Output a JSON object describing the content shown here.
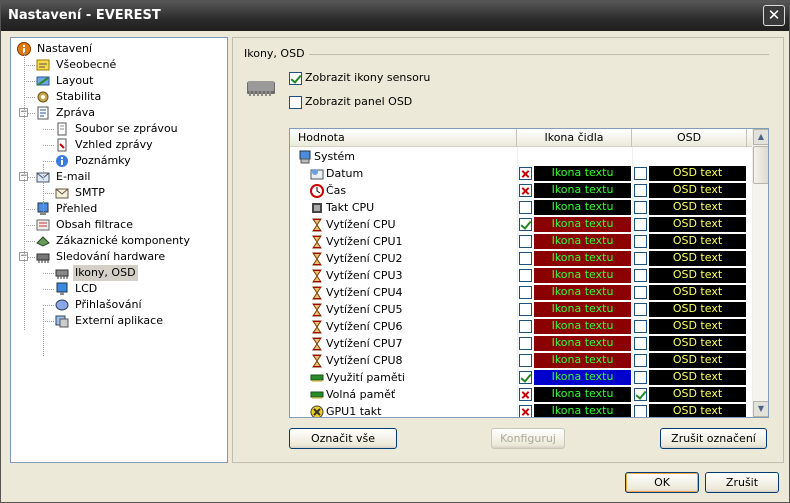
{
  "window": {
    "title": "Nastavení - EVEREST",
    "close_glyph": "✕"
  },
  "tree": [
    {
      "label": "Nastavení",
      "icon": "info-icon",
      "level": 0,
      "expander": ""
    },
    {
      "label": "Všeobecné",
      "icon": "general-settings-icon",
      "level": 1,
      "expander": ""
    },
    {
      "label": "Layout",
      "icon": "layout-icon",
      "level": 1,
      "expander": ""
    },
    {
      "label": "Stabilita",
      "icon": "stability-icon",
      "level": 1,
      "expander": ""
    },
    {
      "label": "Zpráva",
      "icon": "report-icon",
      "level": 1,
      "expander": "−"
    },
    {
      "label": "Soubor se zprávou",
      "icon": "report-file-icon",
      "level": 2,
      "expander": ""
    },
    {
      "label": "Vzhled zprávy",
      "icon": "report-look-icon",
      "level": 2,
      "expander": ""
    },
    {
      "label": "Poznámky",
      "icon": "notes-icon",
      "level": 2,
      "expander": ""
    },
    {
      "label": "E-mail",
      "icon": "email-icon",
      "level": 1,
      "expander": "−"
    },
    {
      "label": "SMTP",
      "icon": "smtp-icon",
      "level": 2,
      "expander": ""
    },
    {
      "label": "Přehled",
      "icon": "overview-icon",
      "level": 1,
      "expander": ""
    },
    {
      "label": "Obsah filtrace",
      "icon": "filter-icon",
      "level": 1,
      "expander": ""
    },
    {
      "label": "Zákaznické komponenty",
      "icon": "custom-components-icon",
      "level": 1,
      "expander": ""
    },
    {
      "label": "Sledování hardware",
      "icon": "hardware-monitor-icon",
      "level": 1,
      "expander": "−"
    },
    {
      "label": "Ikony, OSD",
      "icon": "chip-icon",
      "level": 2,
      "expander": "",
      "selected": true
    },
    {
      "label": "LCD",
      "icon": "lcd-icon",
      "level": 2,
      "expander": ""
    },
    {
      "label": "Přihlašování",
      "icon": "logging-icon",
      "level": 2,
      "expander": ""
    },
    {
      "label": "Externí aplikace",
      "icon": "external-app-icon",
      "level": 2,
      "expander": ""
    }
  ],
  "panel": {
    "section_title": "Ikony, OSD",
    "show_sensor_icons": {
      "label": "Zobrazit ikony sensoru",
      "checked": true
    },
    "show_osd_panel": {
      "label": "Zobrazit panel OSD",
      "checked": false
    },
    "columns": {
      "name": "Hodnota",
      "icon": "Ikona čidla",
      "osd": "OSD"
    },
    "rows": [
      {
        "name": "Systém",
        "icon": "computer-icon",
        "group": true
      },
      {
        "name": "Datum",
        "icon": "date-icon",
        "icon_state": "crossed",
        "icon_text": "Ikona textu",
        "icon_bg": "#000000",
        "osd_state": "empty",
        "osd_text": "OSD text"
      },
      {
        "name": "Čas",
        "icon": "clock-icon",
        "icon_state": "crossed",
        "icon_text": "Ikona textu",
        "icon_bg": "#000000",
        "osd_state": "empty",
        "osd_text": "OSD text"
      },
      {
        "name": "Takt CPU",
        "icon": "cpu-icon",
        "icon_state": "empty",
        "icon_text": "Ikona textu",
        "icon_bg": "#000000",
        "osd_state": "empty",
        "osd_text": "OSD text"
      },
      {
        "name": "Vytížení CPU",
        "icon": "hourglass-icon",
        "icon_state": "checked",
        "icon_text": "Ikona textu",
        "icon_bg": "#8b0000",
        "osd_state": "empty",
        "osd_text": "OSD text"
      },
      {
        "name": "Vytížení CPU1",
        "icon": "hourglass-icon",
        "icon_state": "empty",
        "icon_text": "Ikona textu",
        "icon_bg": "#8b0000",
        "osd_state": "empty",
        "osd_text": "OSD text"
      },
      {
        "name": "Vytížení CPU2",
        "icon": "hourglass-icon",
        "icon_state": "empty",
        "icon_text": "Ikona textu",
        "icon_bg": "#8b0000",
        "osd_state": "empty",
        "osd_text": "OSD text"
      },
      {
        "name": "Vytížení CPU3",
        "icon": "hourglass-icon",
        "icon_state": "empty",
        "icon_text": "Ikona textu",
        "icon_bg": "#8b0000",
        "osd_state": "empty",
        "osd_text": "OSD text"
      },
      {
        "name": "Vytížení CPU4",
        "icon": "hourglass-icon",
        "icon_state": "empty",
        "icon_text": "Ikona textu",
        "icon_bg": "#8b0000",
        "osd_state": "empty",
        "osd_text": "OSD text"
      },
      {
        "name": "Vytížení CPU5",
        "icon": "hourglass-icon",
        "icon_state": "empty",
        "icon_text": "Ikona textu",
        "icon_bg": "#8b0000",
        "osd_state": "empty",
        "osd_text": "OSD text"
      },
      {
        "name": "Vytížení CPU6",
        "icon": "hourglass-icon",
        "icon_state": "empty",
        "icon_text": "Ikona textu",
        "icon_bg": "#8b0000",
        "osd_state": "empty",
        "osd_text": "OSD text"
      },
      {
        "name": "Vytížení CPU7",
        "icon": "hourglass-icon",
        "icon_state": "empty",
        "icon_text": "Ikona textu",
        "icon_bg": "#8b0000",
        "osd_state": "empty",
        "osd_text": "OSD text"
      },
      {
        "name": "Vytížení CPU8",
        "icon": "hourglass-icon",
        "icon_state": "empty",
        "icon_text": "Ikona textu",
        "icon_bg": "#8b0000",
        "osd_state": "empty",
        "osd_text": "OSD text"
      },
      {
        "name": "Využití paměti",
        "icon": "memory-icon",
        "icon_state": "checked",
        "icon_text": "Ikona textu",
        "icon_bg": "#0000cc",
        "osd_state": "empty",
        "osd_text": "OSD text"
      },
      {
        "name": "Volná paměť",
        "icon": "memory-icon",
        "icon_state": "crossed",
        "icon_text": "Ikona textu",
        "icon_bg": "#000000",
        "osd_state": "checked",
        "osd_text": "OSD text"
      },
      {
        "name": "GPU1 takt",
        "icon": "gpu-icon",
        "icon_state": "crossed",
        "icon_text": "Ikona textu",
        "icon_bg": "#000000",
        "osd_state": "empty",
        "osd_text": "OSD text"
      }
    ],
    "colors": {
      "icon_text": "#33ff33",
      "osd_text": "#ffff66",
      "osd_bg": "#000000"
    },
    "buttons": {
      "select_all": "Označit vše",
      "configure": "Konfiguruj",
      "clear": "Zrušit označení"
    }
  },
  "footer": {
    "ok": "OK",
    "cancel": "Zrušit"
  }
}
